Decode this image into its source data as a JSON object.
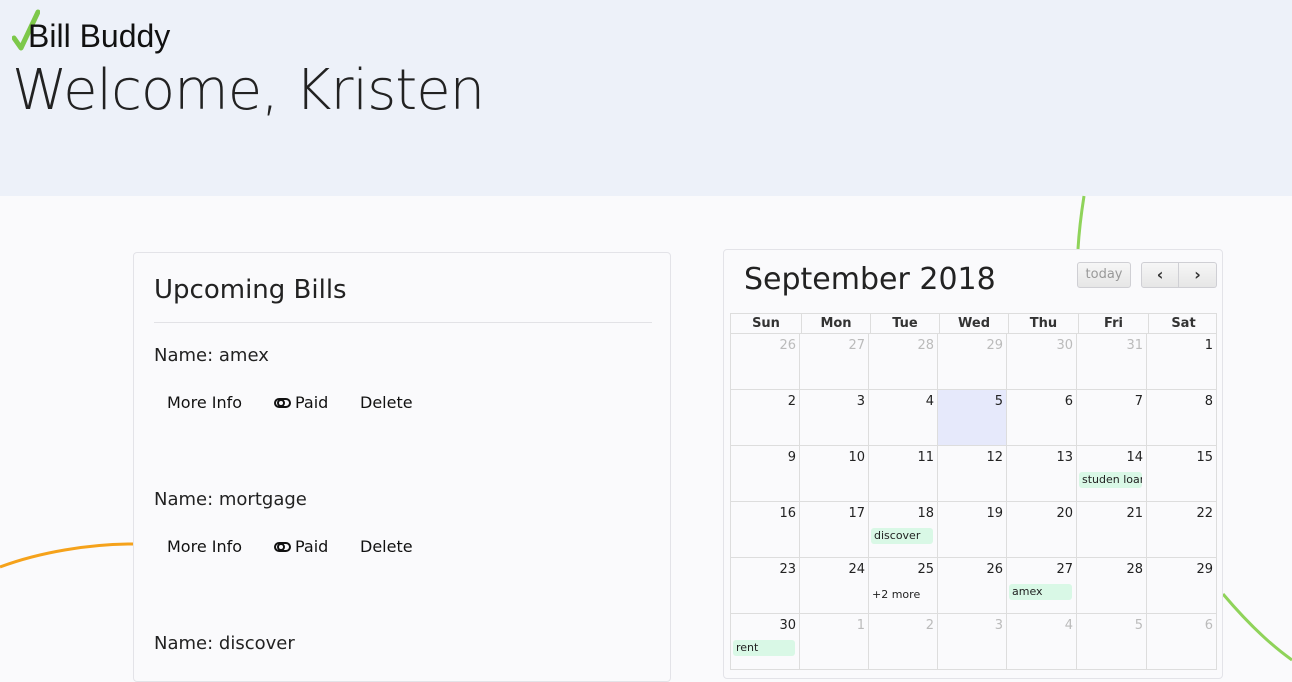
{
  "app": {
    "name": "Bill Buddy"
  },
  "header": {
    "welcome": "Welcome, Kristen"
  },
  "colors": {
    "check": "#7dc84a",
    "header_bg": "#edf1f9",
    "event_bg": "#d9f8e6",
    "today_bg": "#e6e9fb",
    "deco_orange": "#f5a21b",
    "deco_green": "#8fd35a"
  },
  "bills": {
    "title": "Upcoming Bills",
    "items": [
      {
        "name": "Name: amex",
        "more_info": "More Info",
        "paid": "Paid",
        "delete": "Delete"
      },
      {
        "name": "Name: mortgage",
        "more_info": "More Info",
        "paid": "Paid",
        "delete": "Delete"
      },
      {
        "name": "Name: discover"
      }
    ]
  },
  "calendar": {
    "title": "September 2018",
    "today_label": "today",
    "prev_label": "‹",
    "next_label": "›",
    "weekdays": [
      "Sun",
      "Mon",
      "Tue",
      "Wed",
      "Thu",
      "Fri",
      "Sat"
    ],
    "weeks": [
      [
        {
          "d": "26",
          "other": true
        },
        {
          "d": "27",
          "other": true
        },
        {
          "d": "28",
          "other": true
        },
        {
          "d": "29",
          "other": true
        },
        {
          "d": "30",
          "other": true
        },
        {
          "d": "31",
          "other": true
        },
        {
          "d": "1"
        }
      ],
      [
        {
          "d": "2"
        },
        {
          "d": "3"
        },
        {
          "d": "4"
        },
        {
          "d": "5",
          "today": true
        },
        {
          "d": "6"
        },
        {
          "d": "7"
        },
        {
          "d": "8"
        }
      ],
      [
        {
          "d": "9"
        },
        {
          "d": "10"
        },
        {
          "d": "11"
        },
        {
          "d": "12"
        },
        {
          "d": "13"
        },
        {
          "d": "14",
          "event": "studen loan"
        },
        {
          "d": "15"
        }
      ],
      [
        {
          "d": "16"
        },
        {
          "d": "17"
        },
        {
          "d": "18",
          "event": "discover"
        },
        {
          "d": "19"
        },
        {
          "d": "20"
        },
        {
          "d": "21"
        },
        {
          "d": "22"
        }
      ],
      [
        {
          "d": "23"
        },
        {
          "d": "24"
        },
        {
          "d": "25",
          "more": "+2 more"
        },
        {
          "d": "26"
        },
        {
          "d": "27",
          "event": "amex"
        },
        {
          "d": "28"
        },
        {
          "d": "29"
        }
      ],
      [
        {
          "d": "30",
          "event": "rent"
        },
        {
          "d": "1",
          "other": true
        },
        {
          "d": "2",
          "other": true
        },
        {
          "d": "3",
          "other": true
        },
        {
          "d": "4",
          "other": true
        },
        {
          "d": "5",
          "other": true
        },
        {
          "d": "6",
          "other": true
        }
      ]
    ]
  }
}
